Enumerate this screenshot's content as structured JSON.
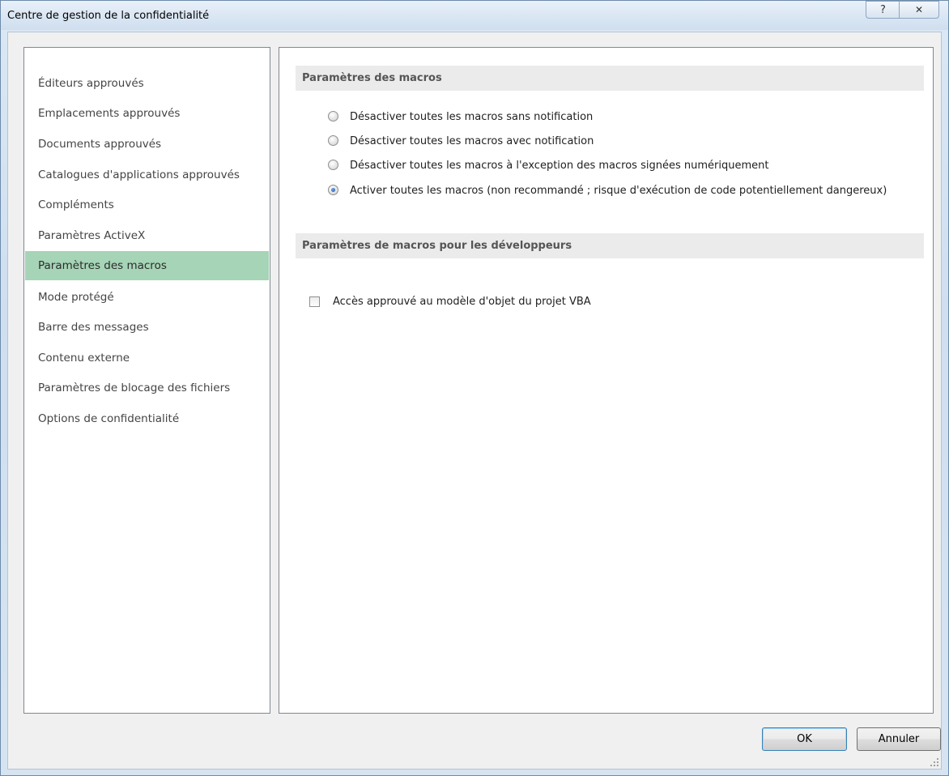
{
  "window": {
    "title": "Centre de gestion de la confidentialité",
    "help_glyph": "?",
    "close_glyph": "✕"
  },
  "sidebar": {
    "items": [
      {
        "label": "Éditeurs approuvés",
        "selected": false
      },
      {
        "label": "Emplacements approuvés",
        "selected": false
      },
      {
        "label": "Documents approuvés",
        "selected": false
      },
      {
        "label": "Catalogues d'applications approuvés",
        "selected": false
      },
      {
        "label": "Compléments",
        "selected": false
      },
      {
        "label": "Paramètres ActiveX",
        "selected": false
      },
      {
        "label": "Paramètres des macros",
        "selected": true
      },
      {
        "label": "Mode protégé",
        "selected": false
      },
      {
        "label": "Barre des messages",
        "selected": false
      },
      {
        "label": "Contenu externe",
        "selected": false
      },
      {
        "label": "Paramètres de blocage des fichiers",
        "selected": false
      },
      {
        "label": "Options de confidentialité",
        "selected": false
      }
    ]
  },
  "macro_settings": {
    "header": "Paramètres des macros",
    "options": [
      {
        "label": "Désactiver toutes les macros sans notification",
        "checked": false
      },
      {
        "label": "Désactiver toutes les macros avec notification",
        "checked": false
      },
      {
        "label": "Désactiver toutes les macros à l'exception des macros signées numériquement",
        "checked": false
      },
      {
        "label": "Activer toutes les macros (non recommandé ; risque d'exécution de code potentiellement dangereux)",
        "checked": true
      }
    ]
  },
  "developer_settings": {
    "header": "Paramètres de macros pour les développeurs",
    "vba_access_label": "Accès approuvé au modèle d'objet du projet VBA",
    "vba_access_checked": false
  },
  "footer": {
    "ok_label": "OK",
    "cancel_label": "Annuler"
  },
  "colors": {
    "selected_item_bg": "#a5d4b6",
    "section_header_bg": "#ebebeb",
    "titlebar": "#dbe7f4"
  },
  "icons": {
    "help": "help-icon",
    "close": "close-icon",
    "resize": "resize-grip-icon"
  }
}
